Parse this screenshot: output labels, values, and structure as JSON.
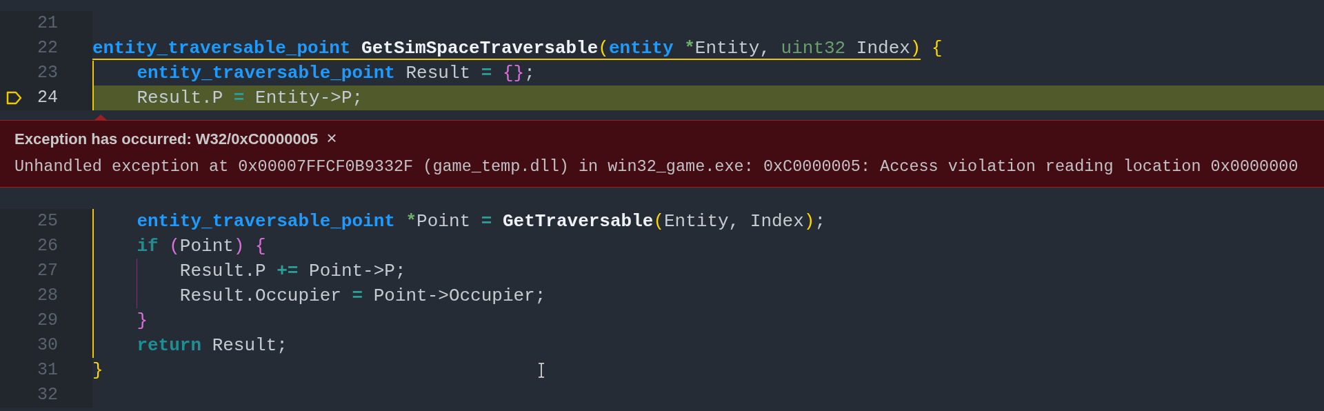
{
  "lines": [
    {
      "number": "21"
    },
    {
      "number": "22",
      "scope_open": true,
      "tokens": [
        {
          "text": "entity_traversable_point",
          "kind": "type"
        },
        {
          "text": " GetSimSpaceTraversable",
          "kind": "func"
        },
        {
          "text": "(",
          "kind": "paren"
        },
        {
          "text": "entity",
          "kind": "type"
        },
        {
          "text": " *",
          "kind": "ptr"
        },
        {
          "text": "Entity, ",
          "kind": "plain"
        },
        {
          "text": "uint32",
          "kind": "param_type"
        },
        {
          "text": " Index",
          "kind": "plain"
        },
        {
          "text": ")",
          "kind": "paren"
        },
        {
          "text": " {",
          "kind": "paren"
        }
      ]
    },
    {
      "number": "23",
      "scope": true,
      "tokens": [
        {
          "text": "    entity_traversable_point",
          "kind": "type"
        },
        {
          "text": " Result ",
          "kind": "plain"
        },
        {
          "text": "=",
          "kind": "op"
        },
        {
          "text": " {}",
          "kind": "brace"
        },
        {
          "text": ";",
          "kind": "plain"
        }
      ]
    },
    {
      "number": "24",
      "scope": true,
      "current": true,
      "breakpoint": true,
      "tokens": [
        {
          "text": "    Result.P ",
          "kind": "plain"
        },
        {
          "text": "=",
          "kind": "op"
        },
        {
          "text": " Entity->P;",
          "kind": "plain"
        }
      ],
      "exception": {
        "title": "Exception has occurred: W32/0xC0000005",
        "close": "×",
        "message": "Unhandled exception at 0x00007FFCF0B9332F (game_temp.dll) in win32_game.exe: 0xC0000005: Access violation reading location 0x0000000"
      }
    },
    {
      "number": "25",
      "scope": true,
      "tokens": [
        {
          "text": "    entity_traversable_point",
          "kind": "type"
        },
        {
          "text": " *",
          "kind": "ptr"
        },
        {
          "text": "Point ",
          "kind": "plain"
        },
        {
          "text": "=",
          "kind": "op"
        },
        {
          "text": " GetTraversable",
          "kind": "func"
        },
        {
          "text": "(",
          "kind": "paren"
        },
        {
          "text": "Entity, Index",
          "kind": "plain"
        },
        {
          "text": ")",
          "kind": "paren"
        },
        {
          "text": ";",
          "kind": "plain"
        }
      ]
    },
    {
      "number": "26",
      "scope": true,
      "tokens": [
        {
          "text": "    if",
          "kind": "keyword"
        },
        {
          "text": " (",
          "kind": "brace"
        },
        {
          "text": "Point",
          "kind": "plain"
        },
        {
          "text": ")",
          "kind": "brace"
        },
        {
          "text": " {",
          "kind": "brace"
        }
      ]
    },
    {
      "number": "27",
      "scope": true,
      "guide": true,
      "tokens": [
        {
          "text": "        Result.P ",
          "kind": "plain"
        },
        {
          "text": "+=",
          "kind": "op"
        },
        {
          "text": " Point->P;",
          "kind": "plain"
        }
      ]
    },
    {
      "number": "28",
      "scope": true,
      "guide": true,
      "tokens": [
        {
          "text": "        Result.Occupier ",
          "kind": "plain"
        },
        {
          "text": "=",
          "kind": "op"
        },
        {
          "text": " Point->Occupier;",
          "kind": "plain"
        }
      ]
    },
    {
      "number": "29",
      "scope": true,
      "tokens": [
        {
          "text": "    }",
          "kind": "brace"
        }
      ]
    },
    {
      "number": "30",
      "scope": true,
      "tokens": [
        {
          "text": "    return",
          "kind": "keyword"
        },
        {
          "text": " Result;",
          "kind": "plain"
        }
      ]
    },
    {
      "number": "31",
      "tokens": [
        {
          "text": "}",
          "kind": "paren"
        }
      ]
    },
    {
      "number": "32"
    }
  ]
}
